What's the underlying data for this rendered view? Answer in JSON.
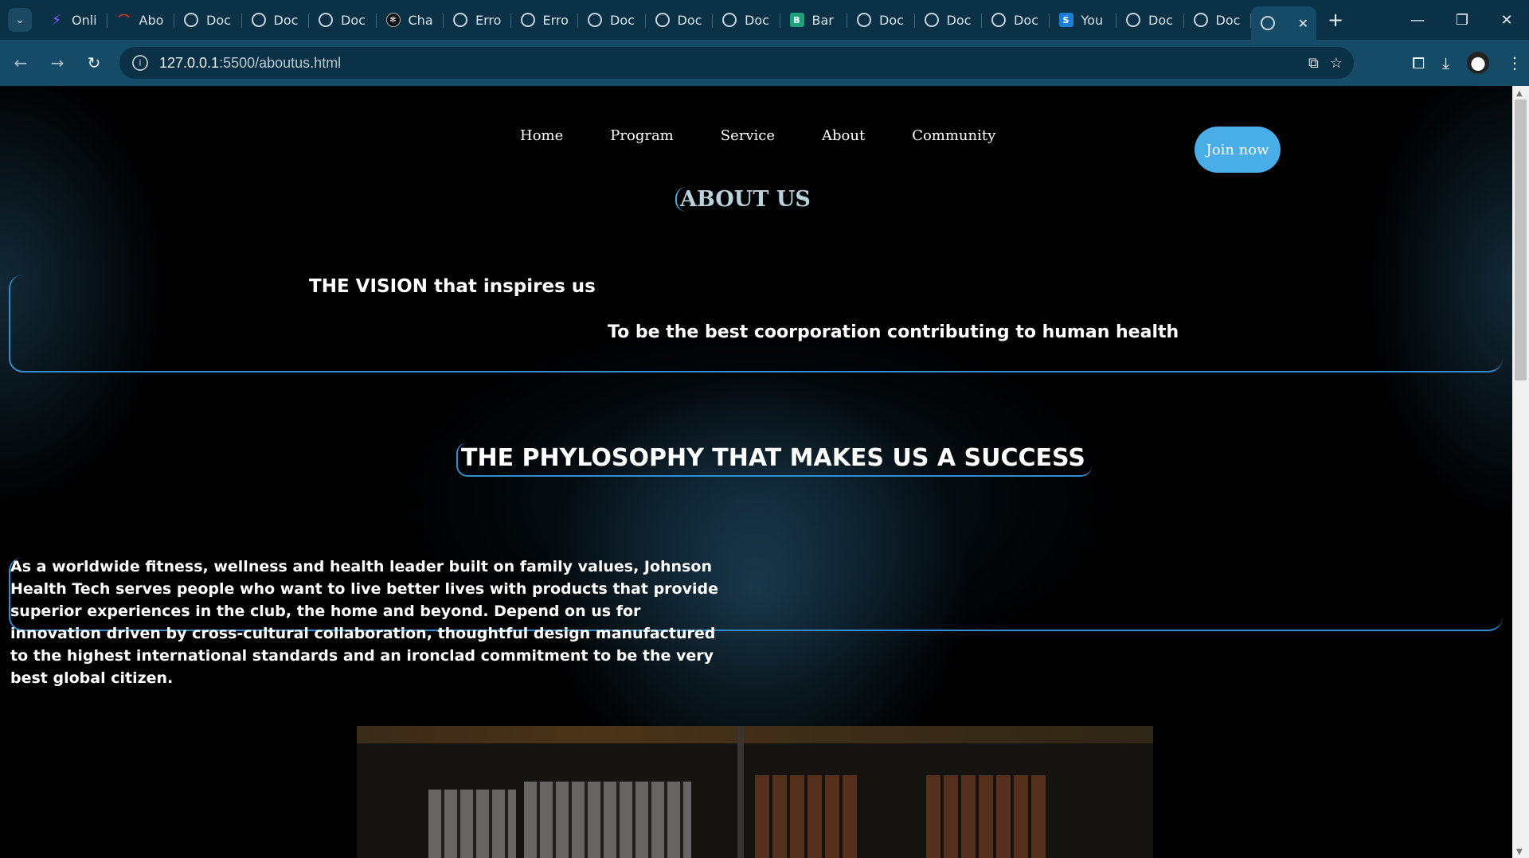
{
  "browser": {
    "tabs": [
      {
        "title": "Onli",
        "icon": "purple-logo-icon"
      },
      {
        "title": "Abo",
        "icon": "red-logo-icon"
      },
      {
        "title": "Doc",
        "icon": "globe-icon"
      },
      {
        "title": "Doc",
        "icon": "globe-icon"
      },
      {
        "title": "Doc",
        "icon": "globe-icon"
      },
      {
        "title": "Cha",
        "icon": "chatgpt-icon"
      },
      {
        "title": "Erro",
        "icon": "globe-icon"
      },
      {
        "title": "Erro",
        "icon": "globe-icon"
      },
      {
        "title": "Doc",
        "icon": "globe-icon"
      },
      {
        "title": "Doc",
        "icon": "globe-icon"
      },
      {
        "title": "Doc",
        "icon": "globe-icon"
      },
      {
        "title": "Bar",
        "icon": "teal-logo-icon"
      },
      {
        "title": "Doc",
        "icon": "globe-icon"
      },
      {
        "title": "Doc",
        "icon": "globe-icon"
      },
      {
        "title": "Doc",
        "icon": "globe-icon"
      },
      {
        "title": "You",
        "icon": "blue-s-logo-icon"
      },
      {
        "title": "Doc",
        "icon": "globe-icon"
      },
      {
        "title": "Doc",
        "icon": "globe-icon"
      }
    ],
    "url_host": "127.0.0.1",
    "url_path": ":5500/aboutus.html"
  },
  "nav": {
    "home": "Home",
    "program": "Program",
    "service": "Service",
    "about": "About",
    "community": "Community",
    "join": "Join now"
  },
  "about": {
    "title": "ABOUT US",
    "vision_heading": "THE VISION that inspires us",
    "vision_text": "To be the best coorporation contributing to human health",
    "philosophy_heading": "THE PHYLOSOPHY THAT MAKES US A SUCCESS",
    "philosophy_text": "As a worldwide fitness, wellness and health leader built on family values, Johnson Health Tech serves people who want to live better lives with products that provide superior experiences in the club, the home and beyond. Depend on us for innovation driven by cross-cultural collaboration, thoughtful design manufactured to the highest international standards and an ironclad commitment to be the very best global citizen."
  },
  "colors": {
    "accent": "#49aee8",
    "border": "#2f8dd0",
    "background": "#000000",
    "chrome": "#154b66"
  }
}
